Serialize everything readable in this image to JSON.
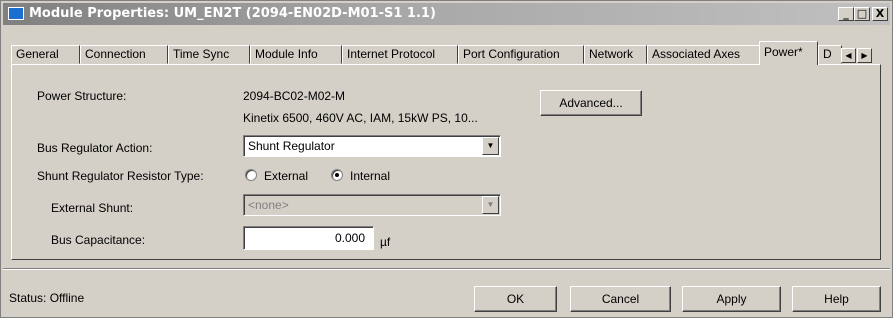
{
  "window": {
    "title": "Module Properties: UM_EN2T (2094-EN02D-M01-S1 1.1)",
    "minimize": "_",
    "maximize": "□",
    "close": "X"
  },
  "tabs": [
    {
      "label": "General"
    },
    {
      "label": "Connection"
    },
    {
      "label": "Time Sync"
    },
    {
      "label": "Module Info"
    },
    {
      "label": "Internet Protocol"
    },
    {
      "label": "Port Configuration"
    },
    {
      "label": "Network"
    },
    {
      "label": "Associated Axes"
    },
    {
      "label": "Power*"
    },
    {
      "label": "D"
    }
  ],
  "tab_scroll": {
    "left": "◀",
    "right": "▶"
  },
  "power": {
    "structure_label": "Power Structure:",
    "structure_value": "2094-BC02-M02-M",
    "structure_desc": "Kinetix 6500, 460V AC, IAM, 15kW PS, 10...",
    "advanced_button": "Advanced...",
    "bus_reg_label": "Bus Regulator Action:",
    "bus_reg_value": "Shunt Regulator",
    "shunt_type_label": "Shunt Regulator Resistor Type:",
    "shunt_external": "External",
    "shunt_internal": "Internal",
    "shunt_selected": "Internal",
    "ext_shunt_label": "External Shunt:",
    "ext_shunt_value": "<none>",
    "bus_cap_label": "Bus Capacitance:",
    "bus_cap_value": "0.000",
    "bus_cap_unit": "µf"
  },
  "footer": {
    "status": "Status:  Offline",
    "ok": "OK",
    "cancel": "Cancel",
    "apply": "Apply",
    "help": "Help"
  }
}
